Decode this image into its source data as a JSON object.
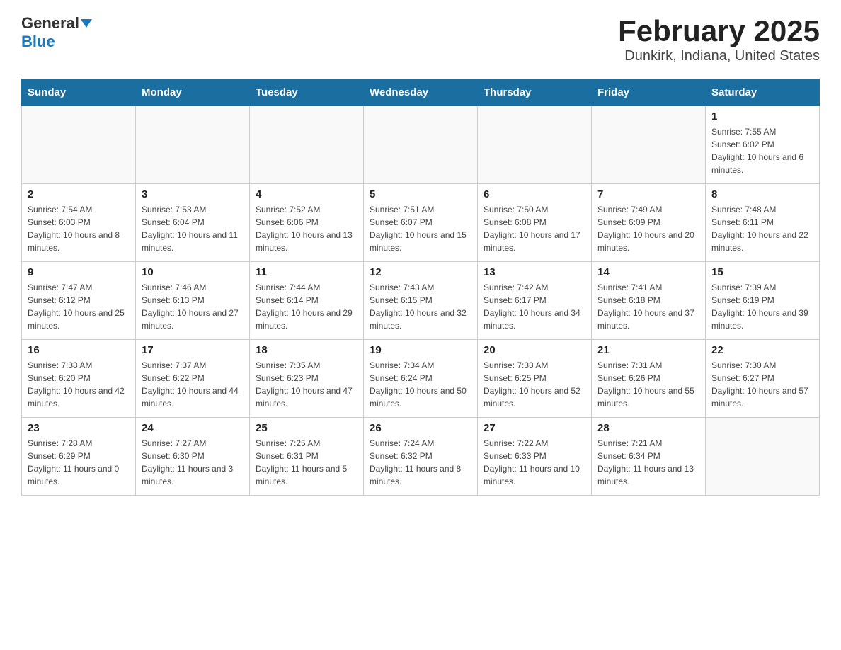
{
  "header": {
    "logo_general": "General",
    "logo_blue": "Blue",
    "title": "February 2025",
    "subtitle": "Dunkirk, Indiana, United States"
  },
  "days_of_week": [
    "Sunday",
    "Monday",
    "Tuesday",
    "Wednesday",
    "Thursday",
    "Friday",
    "Saturday"
  ],
  "weeks": [
    [
      {
        "day": "",
        "info": ""
      },
      {
        "day": "",
        "info": ""
      },
      {
        "day": "",
        "info": ""
      },
      {
        "day": "",
        "info": ""
      },
      {
        "day": "",
        "info": ""
      },
      {
        "day": "",
        "info": ""
      },
      {
        "day": "1",
        "info": "Sunrise: 7:55 AM\nSunset: 6:02 PM\nDaylight: 10 hours and 6 minutes."
      }
    ],
    [
      {
        "day": "2",
        "info": "Sunrise: 7:54 AM\nSunset: 6:03 PM\nDaylight: 10 hours and 8 minutes."
      },
      {
        "day": "3",
        "info": "Sunrise: 7:53 AM\nSunset: 6:04 PM\nDaylight: 10 hours and 11 minutes."
      },
      {
        "day": "4",
        "info": "Sunrise: 7:52 AM\nSunset: 6:06 PM\nDaylight: 10 hours and 13 minutes."
      },
      {
        "day": "5",
        "info": "Sunrise: 7:51 AM\nSunset: 6:07 PM\nDaylight: 10 hours and 15 minutes."
      },
      {
        "day": "6",
        "info": "Sunrise: 7:50 AM\nSunset: 6:08 PM\nDaylight: 10 hours and 17 minutes."
      },
      {
        "day": "7",
        "info": "Sunrise: 7:49 AM\nSunset: 6:09 PM\nDaylight: 10 hours and 20 minutes."
      },
      {
        "day": "8",
        "info": "Sunrise: 7:48 AM\nSunset: 6:11 PM\nDaylight: 10 hours and 22 minutes."
      }
    ],
    [
      {
        "day": "9",
        "info": "Sunrise: 7:47 AM\nSunset: 6:12 PM\nDaylight: 10 hours and 25 minutes."
      },
      {
        "day": "10",
        "info": "Sunrise: 7:46 AM\nSunset: 6:13 PM\nDaylight: 10 hours and 27 minutes."
      },
      {
        "day": "11",
        "info": "Sunrise: 7:44 AM\nSunset: 6:14 PM\nDaylight: 10 hours and 29 minutes."
      },
      {
        "day": "12",
        "info": "Sunrise: 7:43 AM\nSunset: 6:15 PM\nDaylight: 10 hours and 32 minutes."
      },
      {
        "day": "13",
        "info": "Sunrise: 7:42 AM\nSunset: 6:17 PM\nDaylight: 10 hours and 34 minutes."
      },
      {
        "day": "14",
        "info": "Sunrise: 7:41 AM\nSunset: 6:18 PM\nDaylight: 10 hours and 37 minutes."
      },
      {
        "day": "15",
        "info": "Sunrise: 7:39 AM\nSunset: 6:19 PM\nDaylight: 10 hours and 39 minutes."
      }
    ],
    [
      {
        "day": "16",
        "info": "Sunrise: 7:38 AM\nSunset: 6:20 PM\nDaylight: 10 hours and 42 minutes."
      },
      {
        "day": "17",
        "info": "Sunrise: 7:37 AM\nSunset: 6:22 PM\nDaylight: 10 hours and 44 minutes."
      },
      {
        "day": "18",
        "info": "Sunrise: 7:35 AM\nSunset: 6:23 PM\nDaylight: 10 hours and 47 minutes."
      },
      {
        "day": "19",
        "info": "Sunrise: 7:34 AM\nSunset: 6:24 PM\nDaylight: 10 hours and 50 minutes."
      },
      {
        "day": "20",
        "info": "Sunrise: 7:33 AM\nSunset: 6:25 PM\nDaylight: 10 hours and 52 minutes."
      },
      {
        "day": "21",
        "info": "Sunrise: 7:31 AM\nSunset: 6:26 PM\nDaylight: 10 hours and 55 minutes."
      },
      {
        "day": "22",
        "info": "Sunrise: 7:30 AM\nSunset: 6:27 PM\nDaylight: 10 hours and 57 minutes."
      }
    ],
    [
      {
        "day": "23",
        "info": "Sunrise: 7:28 AM\nSunset: 6:29 PM\nDaylight: 11 hours and 0 minutes."
      },
      {
        "day": "24",
        "info": "Sunrise: 7:27 AM\nSunset: 6:30 PM\nDaylight: 11 hours and 3 minutes."
      },
      {
        "day": "25",
        "info": "Sunrise: 7:25 AM\nSunset: 6:31 PM\nDaylight: 11 hours and 5 minutes."
      },
      {
        "day": "26",
        "info": "Sunrise: 7:24 AM\nSunset: 6:32 PM\nDaylight: 11 hours and 8 minutes."
      },
      {
        "day": "27",
        "info": "Sunrise: 7:22 AM\nSunset: 6:33 PM\nDaylight: 11 hours and 10 minutes."
      },
      {
        "day": "28",
        "info": "Sunrise: 7:21 AM\nSunset: 6:34 PM\nDaylight: 11 hours and 13 minutes."
      },
      {
        "day": "",
        "info": ""
      }
    ]
  ]
}
